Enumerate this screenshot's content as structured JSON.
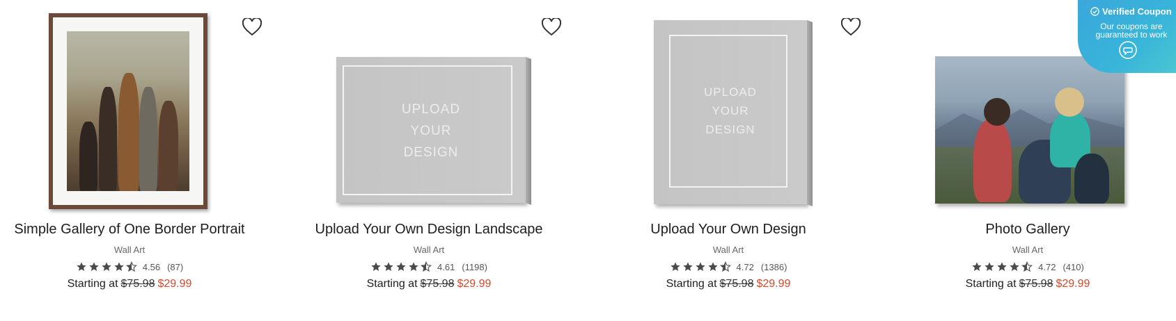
{
  "products": [
    {
      "title": "Simple Gallery of One Border Portrait",
      "category": "Wall Art",
      "rating": "4.56",
      "count": "(87)",
      "price_label": "Starting at",
      "old_price": "$75.98",
      "sale_price": "$29.99",
      "stars_full": 4,
      "stars_half": 1
    },
    {
      "title": "Upload Your Own Design Landscape",
      "category": "Wall Art",
      "rating": "4.61",
      "count": "(1198)",
      "price_label": "Starting at",
      "old_price": "$75.98",
      "sale_price": "$29.99",
      "placeholder": [
        "UPLOAD",
        "YOUR",
        "DESIGN"
      ],
      "stars_full": 4,
      "stars_half": 1
    },
    {
      "title": "Upload Your Own Design",
      "category": "Wall Art",
      "rating": "4.72",
      "count": "(1386)",
      "price_label": "Starting at",
      "old_price": "$75.98",
      "sale_price": "$29.99",
      "placeholder": [
        "UPLOAD",
        "YOUR",
        "DESIGN"
      ],
      "stars_full": 4,
      "stars_half": 1
    },
    {
      "title": "Photo Gallery",
      "category": "Wall Art",
      "rating": "4.72",
      "count": "(410)",
      "price_label": "Starting at",
      "old_price": "$75.98",
      "sale_price": "$29.99",
      "stars_full": 4,
      "stars_half": 1
    }
  ],
  "coupon": {
    "title": "Verified Coupon",
    "line1": "Our coupons are",
    "line2": "guaranteed to work"
  },
  "colors": {
    "sale": "#d4492b",
    "coupon": "#38b5d9",
    "star": "#4a4a4a"
  },
  "icons": {
    "favorite": "heart-outline-icon",
    "coupon_check": "check-circle-icon",
    "chat": "chat-bubble-icon"
  }
}
